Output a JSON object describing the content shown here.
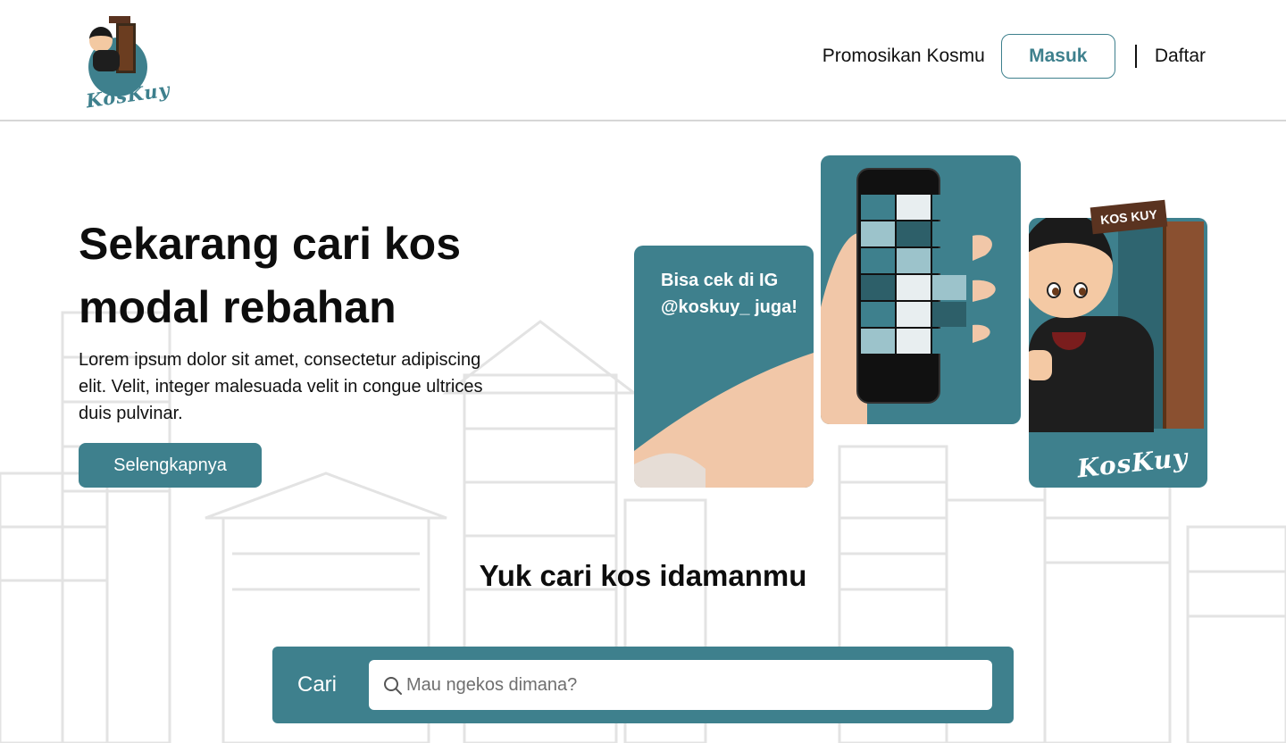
{
  "brand": {
    "logo_text": "KosKuy",
    "logo_sign_text": "KOS KUY"
  },
  "nav": {
    "promote_label": "Promosikan Kosmu",
    "login_label": "Masuk",
    "register_label": "Daftar"
  },
  "hero": {
    "title": "Sekarang cari kos modal rebahan",
    "description": "Lorem ipsum dolor sit amet, consectetur adipiscing elit. Velit, integer malesuada velit in congue ultrices duis pulvinar.",
    "cta_label": "Selengkapnya"
  },
  "promo": {
    "card_text": "Bisa cek di IG @koskuy_ juga!",
    "mascot_sign": "KOS KUY",
    "mascot_logo": "KosKuy"
  },
  "search": {
    "heading": "Yuk cari kos idamanmu",
    "label": "Cari",
    "placeholder": "Mau ngekos dimana?"
  },
  "colors": {
    "accent": "#3e808d",
    "text": "#0d0d0d",
    "divider": "#d6d6d6"
  }
}
